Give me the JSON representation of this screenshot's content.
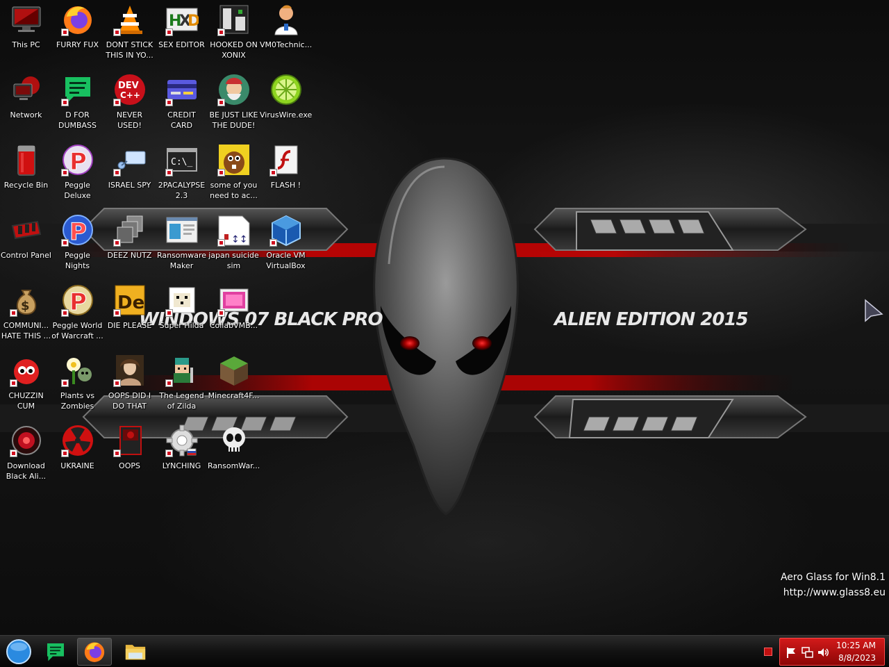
{
  "desktop": {
    "wallpaper": {
      "title_left": "WINDOWS 07 BLACK PRO",
      "title_right": "ALIEN EDITION 2015"
    },
    "icons": [
      {
        "label": "This PC",
        "icon": "computer-icon"
      },
      {
        "label": "FURRY FUX",
        "icon": "firefox-icon"
      },
      {
        "label": "DONT STICK THIS IN YO...",
        "icon": "vlc-cone-icon"
      },
      {
        "label": "SEX EDITOR",
        "icon": "hxd-editor-icon"
      },
      {
        "label": "HOOKED ON XONIX",
        "icon": "xonix-game-icon"
      },
      {
        "label": "VM0Technic...",
        "icon": "doctor-person-icon"
      },
      {
        "label": "Network",
        "icon": "network-icon"
      },
      {
        "label": "D FOR DUMBASS",
        "icon": "green-chat-icon"
      },
      {
        "label": "NEVER USED!",
        "icon": "devcpp-icon"
      },
      {
        "label": "CREDIT CARD CHECKER",
        "icon": "credit-card-icon"
      },
      {
        "label": "BE JUST LIKE THE DUDE!",
        "icon": "character-portrait-icon"
      },
      {
        "label": "VirusWire.exe",
        "icon": "limewire-icon"
      },
      {
        "label": "Recycle Bin",
        "icon": "recycle-bin-icon"
      },
      {
        "label": "Peggle Deluxe",
        "icon": "peggle-icon"
      },
      {
        "label": "ISRAEL SPY",
        "icon": "network-cable-icon"
      },
      {
        "label": "2PACALYPSE 2.3",
        "icon": "console-window-icon"
      },
      {
        "label": "some of you need to ac...",
        "icon": "beaver-character-icon"
      },
      {
        "label": "FLASH !",
        "icon": "flash-document-icon"
      },
      {
        "label": "Control Panel",
        "icon": "control-panel-icon"
      },
      {
        "label": "Peggle Nights Deluxe",
        "icon": "peggle-nights-icon"
      },
      {
        "label": "DEEZ NUTZ",
        "icon": "stacked-windows-icon"
      },
      {
        "label": "Ransomware Maker Build...",
        "icon": "app-window-icon"
      },
      {
        "label": "japan suicide sim",
        "icon": "document-arrows-icon"
      },
      {
        "label": "Oracle VM VirtualBox",
        "icon": "virtualbox-icon"
      },
      {
        "label": "COMMUNI... HATE THIS ...",
        "icon": "money-bag-icon"
      },
      {
        "label": "Peggle World of Warcraft ...",
        "icon": "peggle-wow-icon"
      },
      {
        "label": "DIE PLEASE",
        "icon": "dreamweaver-icon"
      },
      {
        "label": "Super Hilda",
        "icon": "pixel-dog-icon"
      },
      {
        "label": "CollabVMB...",
        "icon": "collab-vm-icon"
      },
      {
        "label": "CHUZZIN CUM",
        "icon": "chuzzle-icon"
      },
      {
        "label": "Plants vs Zombies",
        "icon": "plants-vs-zombies-icon"
      },
      {
        "label": "OOPS DID I DO THAT",
        "icon": "portrait-painting-icon"
      },
      {
        "label": "The Legend of Zilda",
        "icon": "pixel-hero-icon"
      },
      {
        "label": "Minecraft4F...",
        "icon": "minecraft-block-icon"
      },
      {
        "label": "Download Black Ali...",
        "icon": "alien-disc-icon"
      },
      {
        "label": "UKRAINE",
        "icon": "radiation-icon"
      },
      {
        "label": "OOPS",
        "icon": "red-book-icon"
      },
      {
        "label": "LYNCHING",
        "icon": "gear-hands-icon"
      },
      {
        "label": "RansomWar...",
        "icon": "skull-icon"
      }
    ],
    "watermark": {
      "line1": "Aero Glass for Win8.1",
      "line2": "http://www.glass8.eu"
    }
  },
  "taskbar": {
    "buttons": [
      {
        "name": "start-button",
        "icon": "start-orb-icon"
      },
      {
        "name": "taskbar-chat-app",
        "icon": "green-chat-icon"
      },
      {
        "name": "taskbar-firefox",
        "icon": "firefox-icon",
        "active": true
      },
      {
        "name": "taskbar-file-explorer",
        "icon": "folder-icon"
      }
    ],
    "tray": {
      "time": "10:25 AM",
      "date": "8/8/2023",
      "icons": [
        "flag-icon",
        "network-icon",
        "volume-icon"
      ]
    },
    "colors": {
      "tray_bg": "#c41414"
    }
  }
}
